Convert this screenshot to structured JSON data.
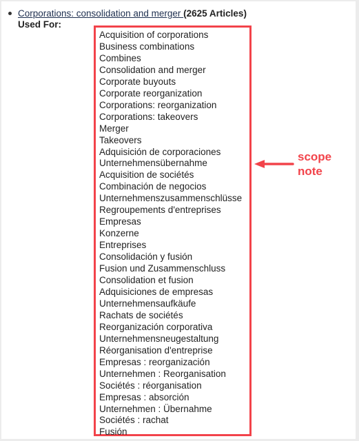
{
  "entry": {
    "link_text": "Corporations: consolidation and merger ",
    "count": "(2625 Articles)",
    "used_for_label": "Used For:"
  },
  "used_for_terms": [
    "Acquisition of corporations",
    "Business combinations",
    "Combines",
    "Consolidation and merger",
    "Corporate buyouts",
    "Corporate reorganization",
    "Corporations: reorganization",
    "Corporations: takeovers",
    "Merger",
    "Takeovers",
    "Adquisición de corporaciones",
    "Unternehmensübernahme",
    "Acquisition de sociétés",
    "Combinación de negocios",
    "Unternehmenszusammenschlüsse",
    "Regroupements d'entreprises",
    "Empresas",
    "Konzerne",
    "Entreprises",
    "Consolidación y fusión",
    "Fusion und Zusammenschluss",
    "Consolidation et fusion",
    "Adquisiciones de empresas",
    "Unternehmensaufkäufe",
    "Rachats de sociétés",
    "Reorganización corporativa",
    "Unternehmensneugestaltung",
    "Réorganisation d'entreprise",
    "Empresas : reorganización",
    "Unternehmen : Reorganisation",
    "Sociétés : réorganisation",
    "Empresas : absorción",
    "Unternehmen : Übernahme",
    "Sociétés : rachat",
    "Fusión"
  ],
  "annotation": {
    "line1": "scope",
    "line2": "note",
    "color": "#f2434a"
  }
}
